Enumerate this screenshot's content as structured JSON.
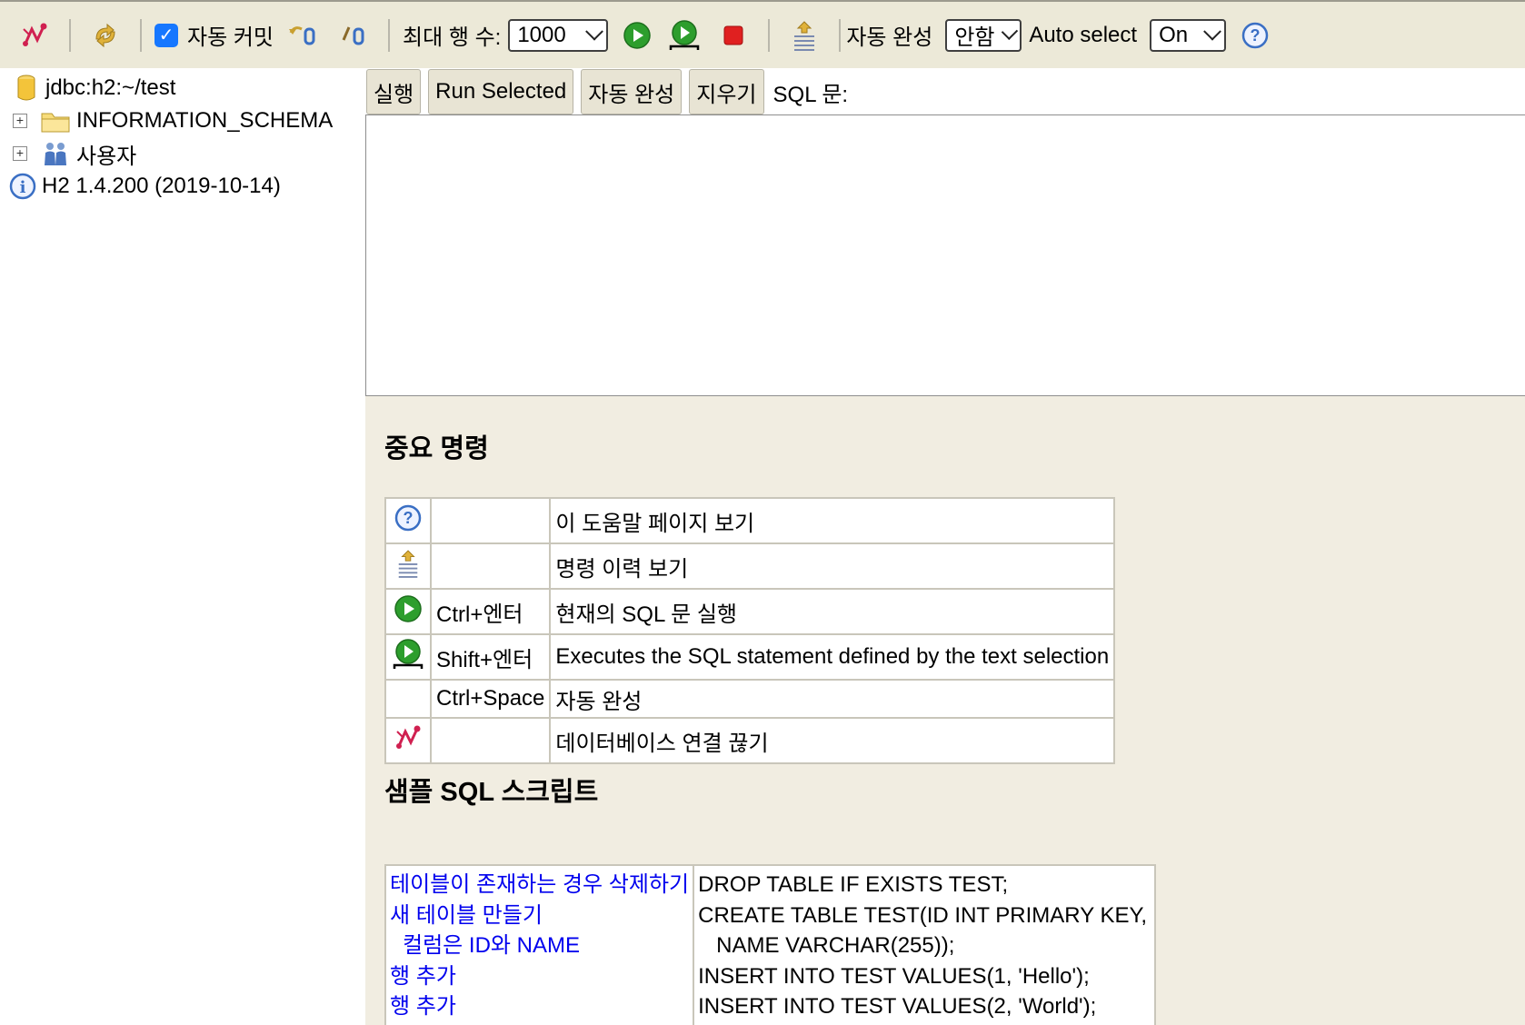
{
  "toolbar": {
    "autocommit_label": "자동 커밋",
    "autocommit_checked": true,
    "max_rows_label": "최대 행 수:",
    "max_rows_value": "1000",
    "autocomplete_label": "자동 완성",
    "autocomplete_value": "안함",
    "autoselect_label": "Auto select",
    "autoselect_value": "On",
    "icons": [
      "disconnect-icon",
      "refresh-icon",
      "rollback-icon",
      "commit-icon",
      "run-icon",
      "run-selected-icon",
      "stop-icon",
      "history-icon",
      "help-icon"
    ]
  },
  "tree": {
    "items": [
      {
        "label": "jdbc:h2:~/test",
        "icon": "database-icon"
      },
      {
        "label": "INFORMATION_SCHEMA",
        "icon": "folder-icon"
      },
      {
        "label": "사용자",
        "icon": "users-icon"
      },
      {
        "label": "H2 1.4.200 (2019-10-14)",
        "icon": "info-icon"
      }
    ]
  },
  "query": {
    "buttons": [
      "실행",
      "Run Selected",
      "자동 완성",
      "지우기"
    ],
    "sql_label": "SQL 문:",
    "sql_text": ""
  },
  "help": {
    "commands_title": "중요 명령",
    "commands": [
      {
        "icon": "help-icon",
        "key": "",
        "desc": "이 도움말 페이지 보기"
      },
      {
        "icon": "history-icon",
        "key": "",
        "desc": "명령 이력 보기"
      },
      {
        "icon": "run-icon",
        "key": "Ctrl+엔터",
        "desc": "현재의 SQL 문 실행"
      },
      {
        "icon": "run-selected-icon",
        "key": "Shift+엔터",
        "desc": "Executes the SQL statement defined by the text selection"
      },
      {
        "icon": "",
        "key": "Ctrl+Space",
        "desc": "자동 완성"
      },
      {
        "icon": "disconnect-icon",
        "key": "",
        "desc": "데이터베이스 연결 끊기"
      }
    ],
    "sample_title": "샘플 SQL 스크립트",
    "sample_left": [
      "테이블이 존재하는 경우 삭제하기",
      "새 테이블 만들기",
      "컬럼은 ID와 NAME",
      "행 추가",
      "행 추가"
    ],
    "sample_right": [
      "DROP TABLE IF EXISTS TEST;",
      "CREATE TABLE TEST(ID INT PRIMARY KEY,",
      "NAME VARCHAR(255));",
      "INSERT INTO TEST VALUES(1, 'Hello');",
      "INSERT INTO TEST VALUES(2, 'World');"
    ]
  },
  "colors": {
    "toolbar_bg": "#ece9d8",
    "help_bg": "#f1ede1",
    "link": "#0000ee",
    "run_green": "#2d9e2d",
    "stop_red": "#e02020",
    "help_blue": "#3a6fc4"
  }
}
